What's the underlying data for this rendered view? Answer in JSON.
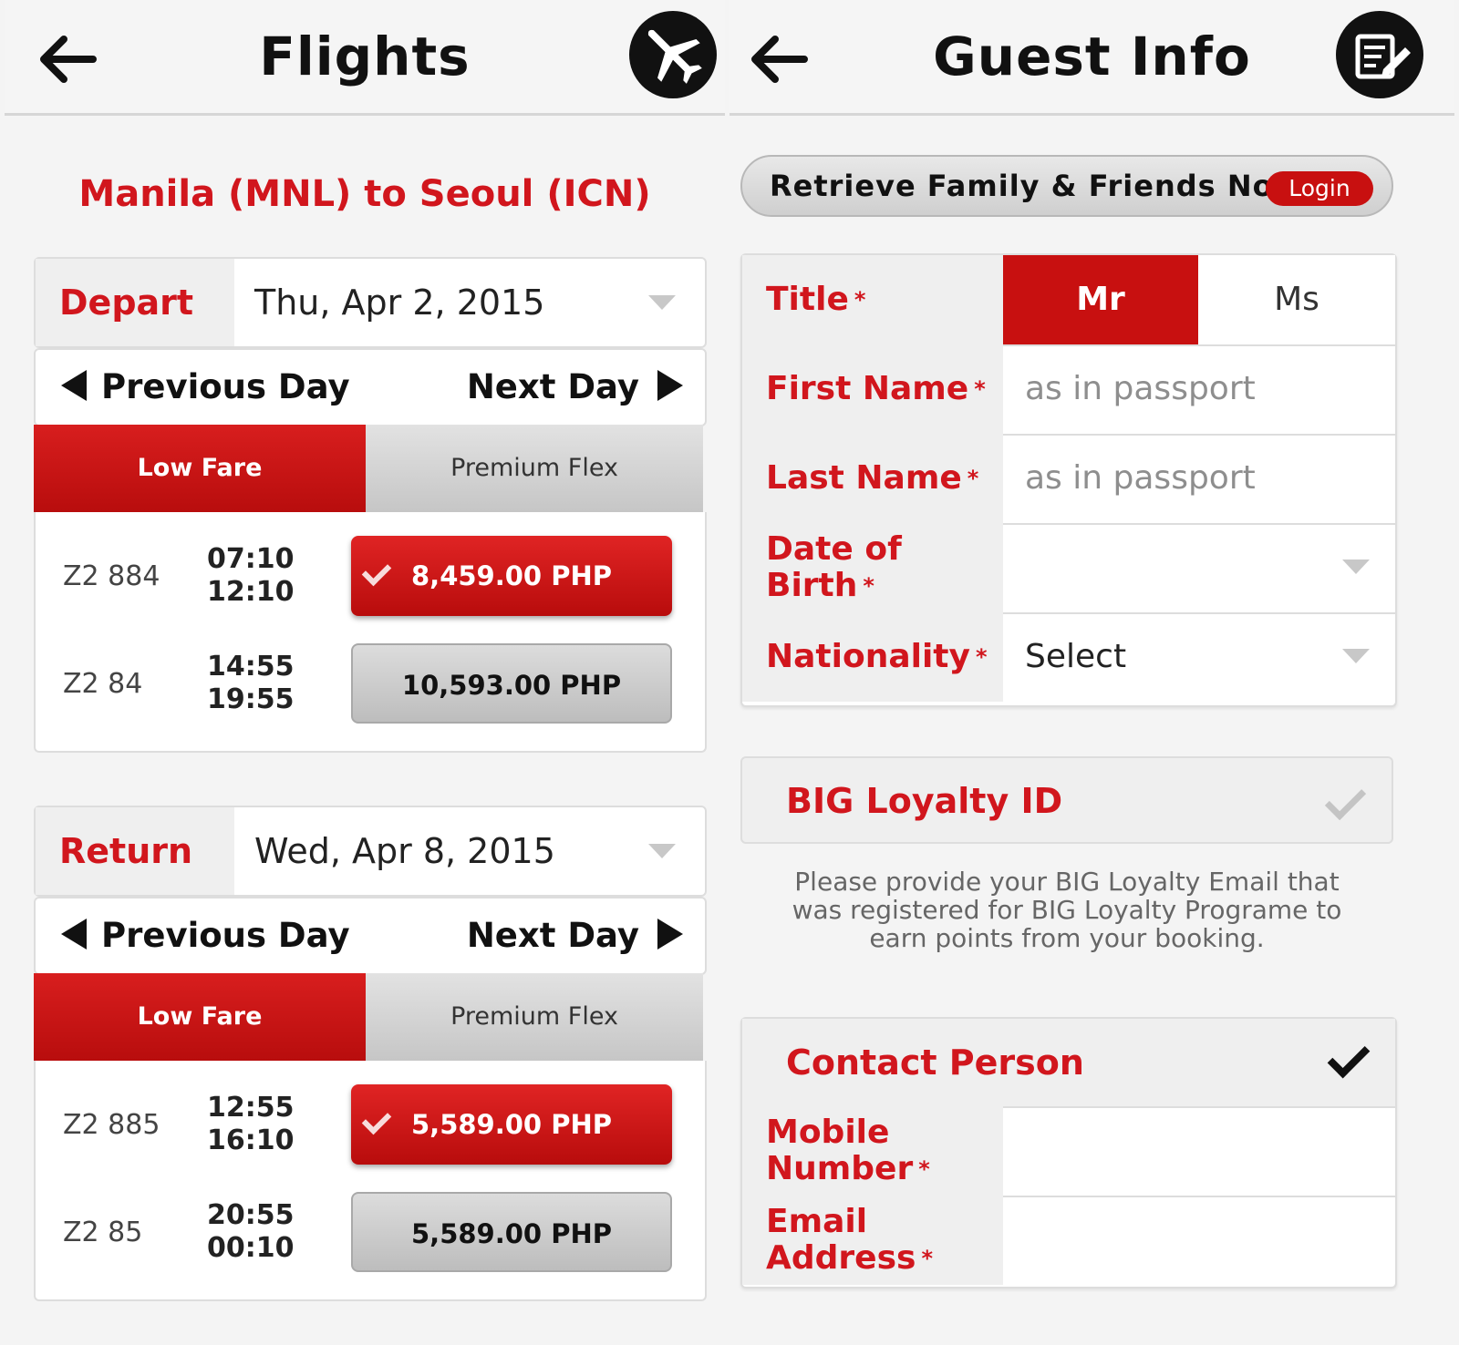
{
  "flights": {
    "title": "Flights",
    "route": "Manila (MNL) to Seoul (ICN)",
    "depart": {
      "label": "Depart",
      "date": "Thu, Apr 2, 2015",
      "prev": "Previous Day",
      "next": "Next Day",
      "tab_low": "Low Fare",
      "tab_premium": "Premium Flex",
      "rows": [
        {
          "flight": "Z2 884",
          "dep": "07:10",
          "arr": "12:10",
          "price": "8,459.00 PHP",
          "selected": true
        },
        {
          "flight": "Z2 84",
          "dep": "14:55",
          "arr": "19:55",
          "price": "10,593.00 PHP",
          "selected": false
        }
      ]
    },
    "return": {
      "label": "Return",
      "date": "Wed, Apr 8, 2015",
      "prev": "Previous Day",
      "next": "Next Day",
      "tab_low": "Low Fare",
      "tab_premium": "Premium Flex",
      "rows": [
        {
          "flight": "Z2 885",
          "dep": "12:55",
          "arr": "16:10",
          "price": "5,589.00 PHP",
          "selected": true
        },
        {
          "flight": "Z2 85",
          "dep": "20:55",
          "arr": "00:10",
          "price": "5,589.00 PHP",
          "selected": false
        }
      ]
    }
  },
  "guest": {
    "title": "Guest Info",
    "retrieve": "Retrieve Family & Friends Now",
    "login": "Login",
    "title_label": "Title",
    "mr": "Mr",
    "ms": "Ms",
    "first_name_label": "First Name",
    "first_name_placeholder": "as in passport",
    "last_name_label": "Last Name",
    "last_name_placeholder": "as in passport",
    "dob_label_1": "Date of",
    "dob_label_2": "Birth",
    "nationality_label": "Nationality",
    "nationality_value": "Select",
    "required_mark": "*",
    "loyalty_title": "BIG Loyalty ID",
    "loyalty_note": "Please provide your BIG Loyalty Email that was registered for BIG Loyalty Programe to earn points from your booking.",
    "contact_title": "Contact Person",
    "mobile_label_1": "Mobile",
    "mobile_label_2": "Number",
    "email_label_1": "Email",
    "email_label_2": "Address"
  },
  "colors": {
    "accent": "#d1161d",
    "selected_fill": "#c81010",
    "panel_grey": "#efefef"
  },
  "icons": {
    "back": "arrow-left-icon",
    "plane": "airplane-icon",
    "edit": "edit-form-icon"
  }
}
